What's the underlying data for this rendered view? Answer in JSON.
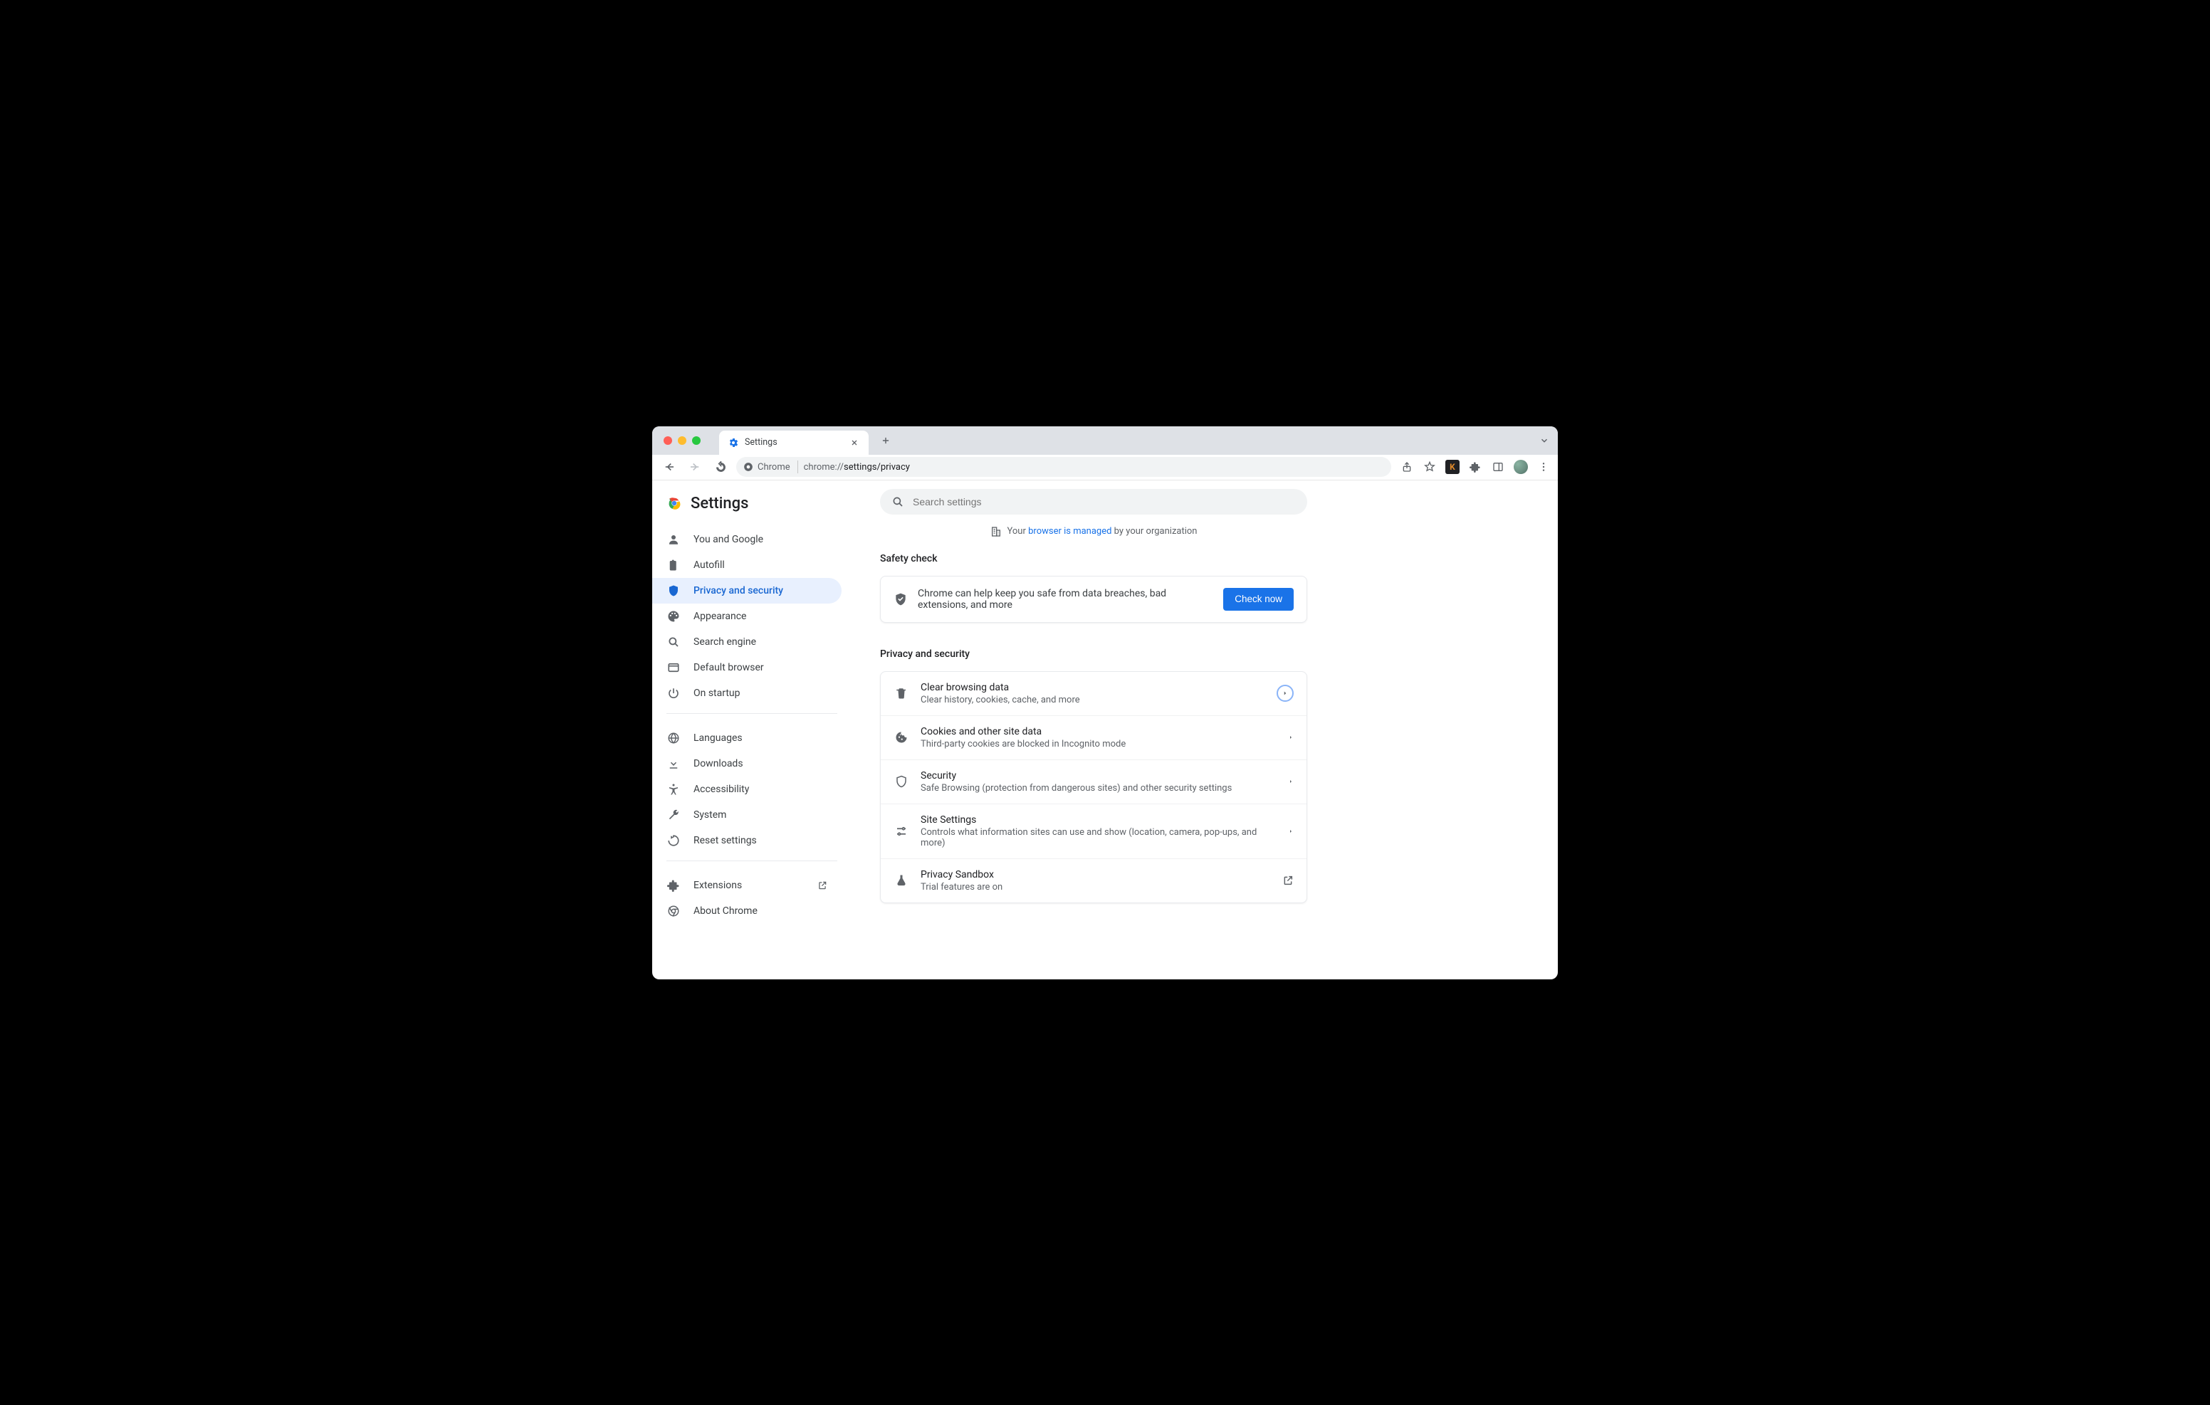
{
  "tab": {
    "title": "Settings"
  },
  "omnibox": {
    "chip": "Chrome",
    "protocol": "chrome://",
    "path": "settings/privacy"
  },
  "header": {
    "title": "Settings"
  },
  "search": {
    "placeholder": "Search settings"
  },
  "managed": {
    "prefix": "Your ",
    "link": "browser is managed",
    "suffix": " by your organization"
  },
  "sidebar": {
    "items": [
      {
        "label": "You and Google"
      },
      {
        "label": "Autofill"
      },
      {
        "label": "Privacy and security"
      },
      {
        "label": "Appearance"
      },
      {
        "label": "Search engine"
      },
      {
        "label": "Default browser"
      },
      {
        "label": "On startup"
      }
    ],
    "items2": [
      {
        "label": "Languages"
      },
      {
        "label": "Downloads"
      },
      {
        "label": "Accessibility"
      },
      {
        "label": "System"
      },
      {
        "label": "Reset settings"
      }
    ],
    "items3": [
      {
        "label": "Extensions"
      },
      {
        "label": "About Chrome"
      }
    ]
  },
  "safety": {
    "title": "Safety check",
    "text": "Chrome can help keep you safe from data breaches, bad extensions, and more",
    "button": "Check now"
  },
  "privacy": {
    "title": "Privacy and security",
    "rows": [
      {
        "title": "Clear browsing data",
        "sub": "Clear history, cookies, cache, and more"
      },
      {
        "title": "Cookies and other site data",
        "sub": "Third-party cookies are blocked in Incognito mode"
      },
      {
        "title": "Security",
        "sub": "Safe Browsing (protection from dangerous sites) and other security settings"
      },
      {
        "title": "Site Settings",
        "sub": "Controls what information sites can use and show (location, camera, pop-ups, and more)"
      },
      {
        "title": "Privacy Sandbox",
        "sub": "Trial features are on"
      }
    ]
  }
}
